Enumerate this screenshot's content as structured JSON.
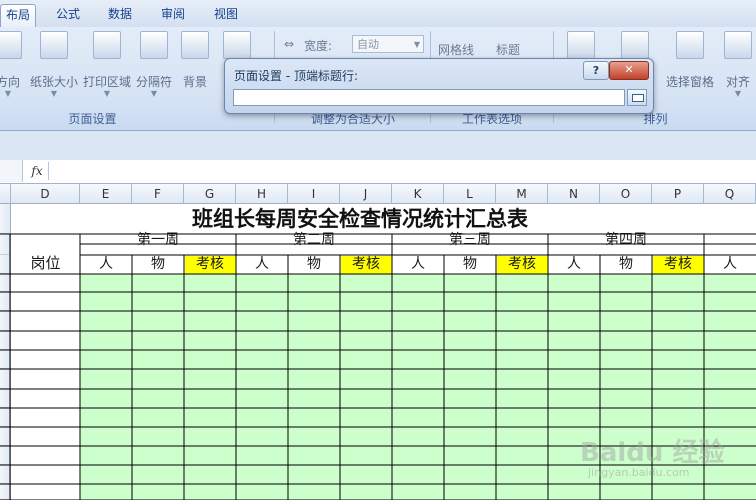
{
  "tabs": [
    {
      "label": "布局",
      "active": true
    },
    {
      "label": "公式"
    },
    {
      "label": "数据"
    },
    {
      "label": "审阅"
    },
    {
      "label": "视图"
    }
  ],
  "ribbon": {
    "buttons": {
      "orientation": "方向",
      "paper_size": "纸张大小",
      "print_area": "打印区域",
      "breaks": "分隔符",
      "background": "背景",
      "selection_pane": "选择窗格",
      "align": "对齐"
    },
    "scale": {
      "width_label": "宽度:",
      "width_value": "自动"
    },
    "sheet_options": {
      "gridlines": "网格线",
      "headings": "标题"
    },
    "groups": {
      "page_setup": "页面设置",
      "scale_to_fit": "调整为合适大小",
      "sheet_options": "工作表选项",
      "arrange": "排列"
    }
  },
  "formula_bar": {
    "fx": "fx",
    "value": ""
  },
  "dialog": {
    "title": "页面设置 - 顶端标题行:",
    "help": "?",
    "close": "✕",
    "input_value": ""
  },
  "columns": [
    "D",
    "E",
    "F",
    "G",
    "H",
    "I",
    "J",
    "K",
    "L",
    "M",
    "N",
    "O",
    "P",
    "Q"
  ],
  "sheet": {
    "title": "班组长每周安全检查情况统计汇总表",
    "position_header": "岗位",
    "weeks": [
      "第一周",
      "第二周",
      "第三周",
      "第四周"
    ],
    "sub_headers": [
      "人",
      "物",
      "考核"
    ],
    "extra_sub": "人"
  },
  "colors": {
    "data_fill": "#ccffcc",
    "highlight": "#ffff00",
    "ribbon_text": "#15428b"
  },
  "watermark": {
    "brand": "Baidu 经验",
    "url": "jingyan.baidu.com"
  }
}
